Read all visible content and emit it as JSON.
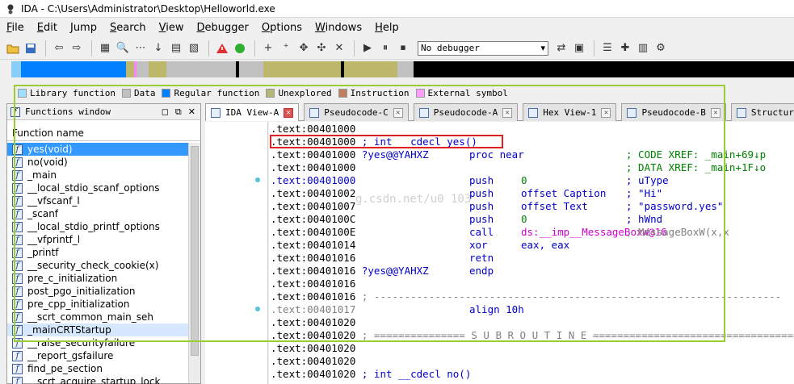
{
  "window": {
    "title": "IDA - C:\\Users\\Administrator\\Desktop\\Helloworld.exe",
    "app_icon": "ida-ant-icon"
  },
  "menu": [
    {
      "label": "File",
      "u": "F",
      "rest": "ile"
    },
    {
      "label": "Edit",
      "u": "E",
      "rest": "dit"
    },
    {
      "label": "Jump",
      "u": "J",
      "rest": "ump"
    },
    {
      "label": "Search",
      "u": "S",
      "rest": "earch"
    },
    {
      "label": "View",
      "u": "V",
      "rest": "iew"
    },
    {
      "label": "Debugger",
      "u": "D",
      "rest": "ebugger"
    },
    {
      "label": "Options",
      "u": "O",
      "rest": "ptions"
    },
    {
      "label": "Windows",
      "u": "W",
      "rest": "indows"
    },
    {
      "label": "Help",
      "u": "H",
      "rest": "elp"
    }
  ],
  "toolbar": {
    "debugger_select": "No debugger"
  },
  "navband": {
    "colors": {
      "library": "#87cefa",
      "regular": "#0080ff",
      "unexplored": "#bdb76b",
      "external": "#ff80ff",
      "data": "#c0c0c0",
      "black": "#000000"
    }
  },
  "legend": [
    {
      "label": "Library function",
      "color": "#9fe0ff"
    },
    {
      "label": "Data",
      "color": "#c0c0c0"
    },
    {
      "label": "Regular function",
      "color": "#0080ff"
    },
    {
      "label": "Unexplored",
      "color": "#b5b57a"
    },
    {
      "label": "Instruction",
      "color": "#c08060"
    },
    {
      "label": "External symbol",
      "color": "#ff9cff"
    }
  ],
  "functions_window": {
    "title": "Functions window",
    "column": "Function name",
    "items": [
      "yes(void)",
      "no(void)",
      "_main",
      "__local_stdio_scanf_options",
      "__vfscanf_l",
      "_scanf",
      "__local_stdio_printf_options",
      "__vfprintf_l",
      "_printf",
      "__security_check_cookie(x)",
      "pre_c_initialization",
      "post_pgo_initialization",
      "pre_cpp_initialization",
      "__scrt_common_main_seh",
      "_mainCRTStartup",
      "__raise_securityfailure",
      "__report_gsfailure",
      "find_pe_section",
      "__scrt_acquire_startup_lock"
    ]
  },
  "tabs": [
    {
      "label": "IDA View-A"
    },
    {
      "label": "Pseudocode-C"
    },
    {
      "label": "Pseudocode-A"
    },
    {
      "label": "Hex View-1"
    },
    {
      "label": "Pseudocode-B"
    },
    {
      "label": "Structur"
    }
  ],
  "disasm": {
    "lines": [
      {
        "addr": ".text:00401000",
        "body": ""
      },
      {
        "addr": ".text:00401000",
        "body": " ; int __cdecl yes()"
      },
      {
        "addr": ".text:00401000",
        "label": " ?yes@@YAHXZ",
        "mn": "proc near",
        "cm": "; CODE XREF: _main+69↓p"
      },
      {
        "addr": ".text:00401000",
        "cm": "; DATA XREF: _main+1F↓o"
      },
      {
        "addr": ".text:00401000",
        "mn": "push",
        "op": "0",
        "cm": "; uType"
      },
      {
        "addr": ".text:00401002",
        "mn": "push",
        "op": "offset Caption",
        "cm": "; \"Hi\""
      },
      {
        "addr": ".text:00401007",
        "mn": "push",
        "op": "offset Text",
        "cm": "; \"password.yes\""
      },
      {
        "addr": ".text:0040100C",
        "mn": "push",
        "op": "0",
        "cm": "; hWnd"
      },
      {
        "addr": ".text:0040100E",
        "mn": "call",
        "op": "ds:__imp__MessageBoxW@16",
        "cm": "; MessageBoxW(x,x"
      },
      {
        "addr": ".text:00401014",
        "mn": "xor",
        "op": "eax, eax"
      },
      {
        "addr": ".text:00401016",
        "mn": "retn"
      },
      {
        "addr": ".text:00401016",
        "label": " ?yes@@YAHXZ",
        "mn": "endp"
      },
      {
        "addr": ".text:00401016",
        "body": ""
      },
      {
        "addr": ".text:00401016",
        "body": " ; -------------------------------------------------------------------"
      },
      {
        "addr": ".text:00401017",
        "mn": "align 10h"
      },
      {
        "addr": ".text:00401020",
        "body": ""
      },
      {
        "addr": ".text:00401020",
        "body": " ; =============== S U B R O U T I N E ======================================="
      },
      {
        "addr": ".text:00401020",
        "body": ""
      },
      {
        "addr": ".text:00401020",
        "body": ""
      },
      {
        "addr": ".text:00401020",
        "body": " ; int __cdecl no()"
      }
    ],
    "watermark": "g.csdn.net/u0 103"
  }
}
